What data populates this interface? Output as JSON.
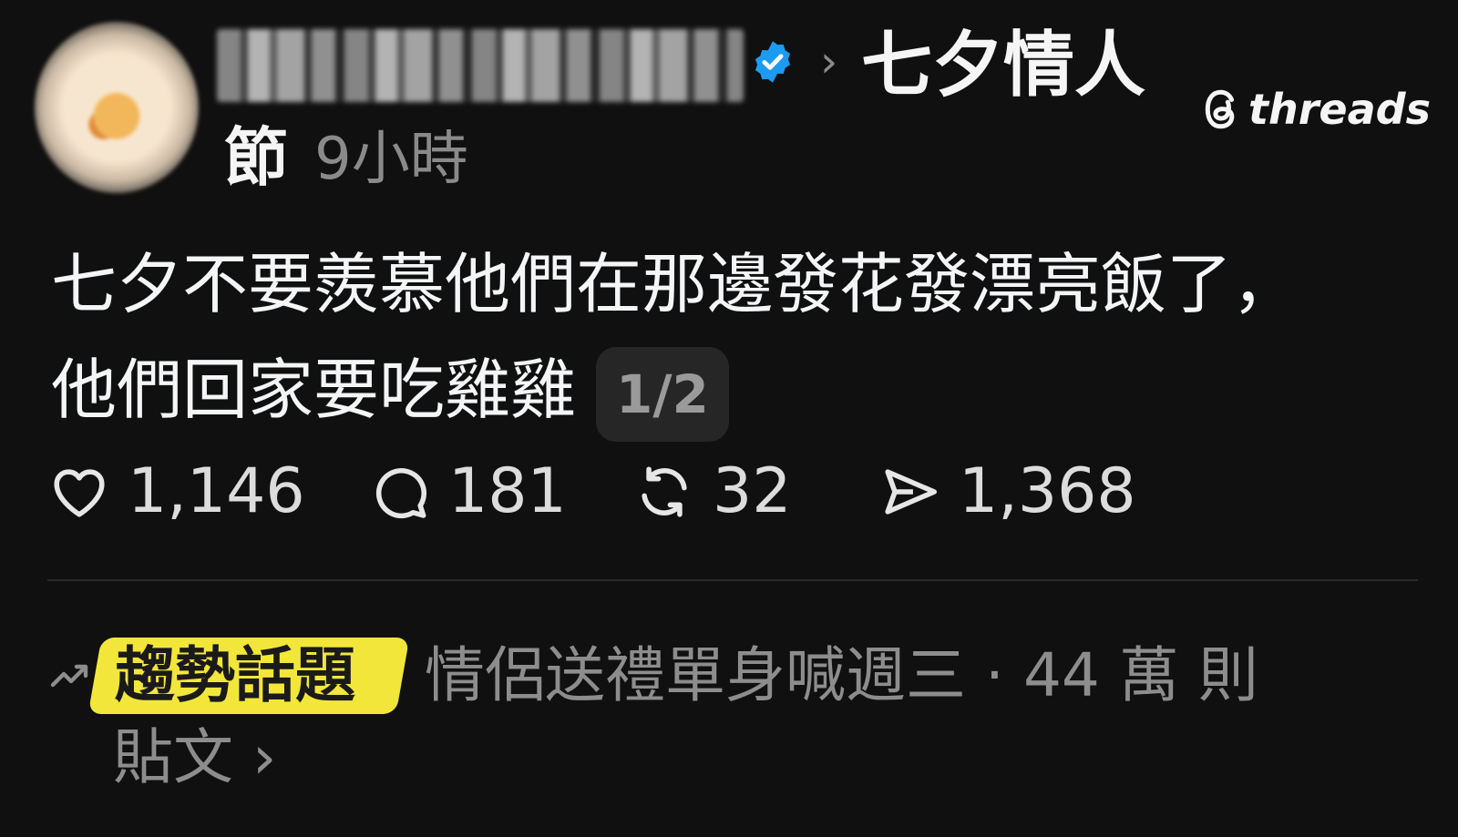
{
  "header": {
    "username": "huangjiu_bread",
    "topic_line1": "七夕情人",
    "topic_line2": "節",
    "time": "9小時",
    "separator": "›"
  },
  "brand": {
    "mark": "@",
    "name": "threads"
  },
  "post": {
    "text": "七夕不要羨慕他們在那邊發花發漂亮飯了，他們回家要吃雞雞",
    "page_indicator": "1/2"
  },
  "actions": {
    "likes": "1,146",
    "replies": "181",
    "reposts": "32",
    "shares": "1,368"
  },
  "trending": {
    "tag": "趨勢話題",
    "line1": "情侶送禮單身喊週三 · 44 萬 則",
    "line2": "貼文",
    "chevron": "›"
  },
  "colors": {
    "background": "#101010",
    "verified_blue": "#1d9bf0",
    "trend_highlight": "#f2e63a",
    "muted_text": "#8d8d8d"
  },
  "icons": [
    "verified-badge-icon",
    "heart-icon",
    "comment-icon",
    "repost-icon",
    "share-icon",
    "trending-icon",
    "chevron-right-icon",
    "threads-logo-icon"
  ]
}
